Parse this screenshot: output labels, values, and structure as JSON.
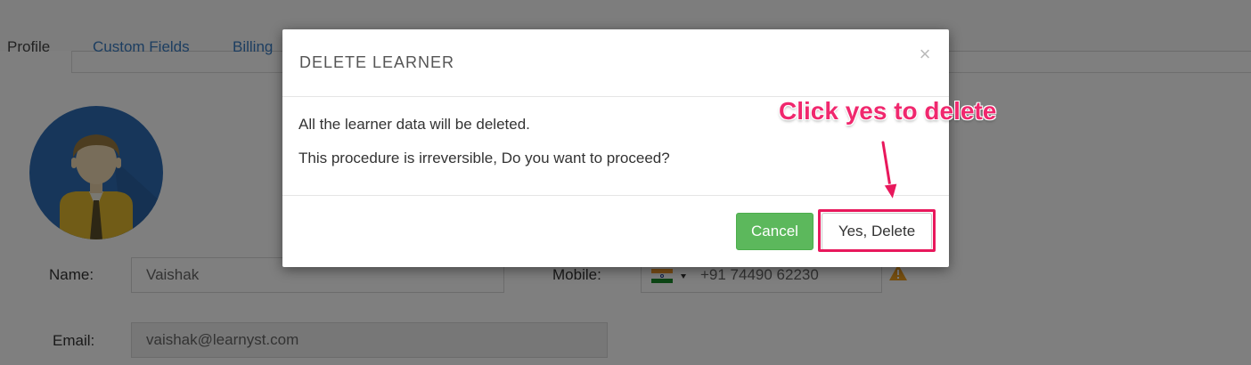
{
  "background": {
    "tabs": [
      {
        "label": "Profile",
        "active": true
      },
      {
        "label": "Custom Fields",
        "active": false
      },
      {
        "label": "Billing",
        "active": false
      }
    ],
    "avatar_icon": "user-avatar-icon",
    "form": {
      "name_label": "Name:",
      "name_value": "Vaishak",
      "email_label": "Email:",
      "email_value": "vaishak@learnyst.com",
      "mobile_label": "Mobile:",
      "mobile_country": "India",
      "mobile_value": "+91 74490 62230",
      "warning_icon": "warning-icon"
    }
  },
  "modal": {
    "title": "DELETE LEARNER",
    "close_symbol": "×",
    "message_line1": "All the learner data will be deleted.",
    "message_line2": "This procedure is irreversible, Do you want to proceed?",
    "cancel_label": "Cancel",
    "confirm_label": "Yes, Delete"
  },
  "annotation": {
    "text": "Click yes to delete",
    "color": "#f0286e"
  },
  "colors": {
    "cancel_button": "#5cb85c",
    "link": "#3a7cc2",
    "avatar_bg": "#2f6db5",
    "highlight": "#e8185c"
  }
}
